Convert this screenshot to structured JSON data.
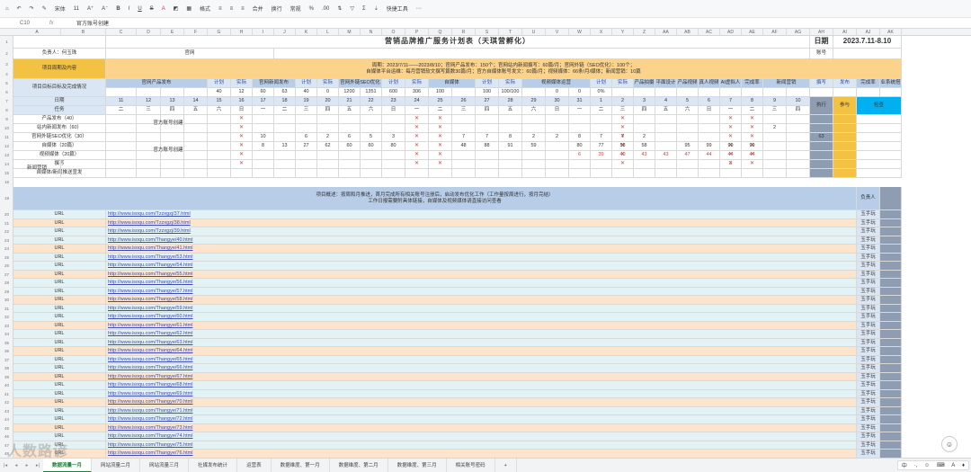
{
  "toolbar": {
    "font": "宋体",
    "size": "11",
    "bold": "B",
    "italic": "I",
    "underline": "U",
    "format": "格式",
    "merge": "合并",
    "wrap": "换行",
    "number": "常规",
    "quick": "快捷工具"
  },
  "formula_bar": {
    "cell_ref": "C10",
    "fx": "fx",
    "value": "官方账号创建"
  },
  "columns": [
    "A",
    "B",
    "C",
    "D",
    "E",
    "F",
    "G",
    "H",
    "I",
    "J",
    "K",
    "L",
    "M",
    "N",
    "O",
    "P",
    "Q",
    "R",
    "S",
    "T",
    "U",
    "V",
    "W",
    "X",
    "Y",
    "Z",
    "AA",
    "AB",
    "AC",
    "AD",
    "AE",
    "AF",
    "AG",
    "AH",
    "AI",
    "AJ",
    "AK"
  ],
  "rows": [
    "1",
    "2",
    "3",
    "4",
    "5",
    "6",
    "7",
    "8",
    "9",
    "10",
    "11",
    "12",
    "13",
    "14",
    "15",
    "16",
    "19",
    "20",
    "21",
    "22",
    "23",
    "24",
    "25",
    "26",
    "27",
    "28",
    "29",
    "30",
    "31",
    "32",
    "33",
    "34",
    "35",
    "36",
    "37",
    "38",
    "39",
    "40",
    "41",
    "42",
    "43",
    "44",
    "45",
    "46",
    "47",
    "48"
  ],
  "sheet": {
    "title": "营销品牌推广服务计划表（天琪营孵化）",
    "date_label": "日期",
    "date_value": "2023.7.11-8.10",
    "owner_label": "负责人：何玉珠",
    "official": "官网",
    "account_label": "账号",
    "project_label": "项目周期及内容",
    "summary_line1": "周期：2023/7/11——2023/8/10；官网产品发布：150个；官网站内新闻撰写：60篇/月；官网外链（SEO优化）：100个；",
    "summary_line2": "自媒体平台运维：每月营销软文撰写篇数30篇/月；官方自媒体账号发文：60篇/月；视频媒体：66条/月/媒体；新闻营销：10篇",
    "goal_label": "项目目标目标及完成情况",
    "groups": [
      "官网产品发布",
      "官网新闻发布",
      "官网外链SEO优化",
      "自媒体",
      "视频媒体运营",
      "产品拍摄",
      "平面设计",
      "产品视频",
      "真人视频",
      "AI虚拟人",
      "完成率",
      "新闻营销",
      "商业系统搭建"
    ],
    "plan": "计划",
    "actual": "实际",
    "done": "完成率",
    "write": "撰写",
    "publish": "发布",
    "exec": "执行",
    "participate": "参与",
    "inspect": "检查",
    "targets": [
      "40",
      "12",
      "60",
      "63",
      "40",
      "0",
      "1200",
      "1351",
      "600",
      "306",
      "100",
      "",
      "100",
      "100/100",
      "",
      "0",
      "0",
      "0%"
    ],
    "weekdays_label": "星期",
    "date_row_label": "日期",
    "task_label": "任务",
    "dates": [
      "11",
      "12",
      "13",
      "14",
      "15",
      "16",
      "17",
      "18",
      "19",
      "20",
      "21",
      "22",
      "23",
      "24",
      "25",
      "26",
      "27",
      "28",
      "29",
      "30",
      "31",
      "1",
      "2",
      "3",
      "4",
      "5",
      "6",
      "7",
      "8",
      "9",
      "10"
    ],
    "weekdays": [
      "二",
      "三",
      "四",
      "五",
      "六",
      "日",
      "一",
      "二",
      "三",
      "四",
      "五",
      "六",
      "日",
      "一",
      "二",
      "三",
      "四",
      "五",
      "六",
      "日",
      "一",
      "二",
      "三",
      "四",
      "五",
      "六",
      "日",
      "一",
      "二",
      "三",
      "四"
    ],
    "tasks": [
      "产品发布（40）",
      "站内新闻发布（60）",
      "官网外链SEO优化（30）",
      "自媒体（20篇）",
      "视频媒体（20篇）",
      "撰写",
      "自媒体/新闻推送宣发"
    ],
    "news_label": "新闻营销",
    "account_create": "官方账号创建",
    "row_vals_12": [
      "8",
      "13",
      "27",
      "62",
      "60",
      "60",
      "80",
      "48",
      "88",
      "91",
      "59",
      "80",
      "77",
      "58",
      "58",
      "95",
      "99",
      "99",
      "99"
    ],
    "row_vals_13": [
      "6",
      "39",
      "40",
      "43",
      "43",
      "47",
      "44",
      "44",
      "44"
    ],
    "row_vals_11": [
      "10",
      "6",
      "2",
      "6",
      "5",
      "3",
      "7",
      "7",
      "8",
      "2",
      "2",
      "8",
      "7",
      "7",
      "2"
    ],
    "row_vals_10": [
      "2"
    ],
    "row_vals_14": [
      "3"
    ],
    "final_col": "63",
    "plan_label": "网计划",
    "desc_line1": "项目概述：按周和月推进，首月完成所有相关账号注册后，启动发布优化工作（工作量按周进行，按月完结）",
    "desc_line2": "工作日报需要附具体链接，自媒体及视频媒体请直接访问查看",
    "resp_label": "负责人",
    "resp_name": "玉手玩",
    "url_label": "URL",
    "links": [
      "http://www.isoqu.com/Tzzxgzj/37.html",
      "http://www.isoqu.com/Tzzxgzj/38.html",
      "http://www.isoqu.com/Tzzxgzj/39.html",
      "http://www.isoqu.com/Thangye/40.html",
      "http://www.isoqu.com/Thangye/41.html",
      "http://www.isoqu.com/Thangye/53.html",
      "http://www.isoqu.com/Thangye/54.html",
      "http://www.isoqu.com/Thangye/55.html",
      "http://www.isoqu.com/Thangye/56.html",
      "http://www.isoqu.com/Thangye/57.html",
      "http://www.isoqu.com/Thangye/58.html",
      "http://www.isoqu.com/Thangye/59.html",
      "http://www.isoqu.com/Thangye/60.html",
      "http://www.isoqu.com/Thangye/61.html",
      "http://www.isoqu.com/Thangye/62.html",
      "http://www.isoqu.com/Thangye/63.html",
      "http://www.isoqu.com/Thangye/64.html",
      "http://www.isoqu.com/Thangye/65.html",
      "http://www.isoqu.com/Thangye/66.html",
      "http://www.isoqu.com/Thangye/67.html",
      "http://www.isoqu.com/Thangye/68.html",
      "http://www.isoqu.com/Thangye/69.html",
      "http://www.isoqu.com/Thangye/70.html",
      "http://www.isoqu.com/Thangye/71.html",
      "http://www.isoqu.com/Thangye/72.html",
      "http://www.isoqu.com/Thangye/73.html",
      "http://www.isoqu.com/Thangye/74.html",
      "http://www.isoqu.com/Thangye/75.html",
      "http://www.isoqu.com/Thangye/76.html"
    ],
    "last_link": "http://www.isoqu.com/Thangye/75.html"
  },
  "tabs": [
    "数据流量一月",
    "网站流量二月",
    "网站流量三月",
    "社媒发布统计",
    "运营表",
    "数据维度、第一月",
    "数据维度、第二月",
    "数据维度、第三月",
    "相关账号密码"
  ],
  "watermark": "人数路谚",
  "ime": [
    "中",
    "·,",
    "☺",
    "⌨",
    "A",
    "♦"
  ]
}
